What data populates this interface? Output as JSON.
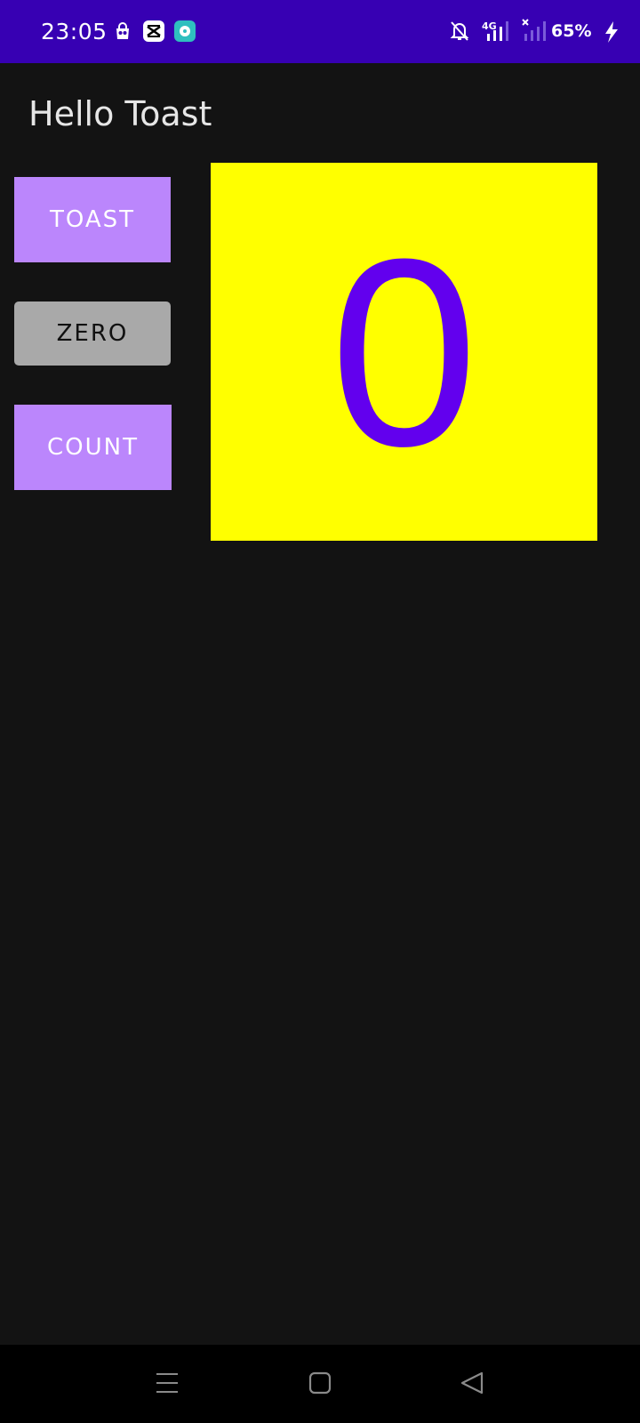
{
  "status_bar": {
    "time": "23:05",
    "network": "4G",
    "battery": "65%",
    "icons": [
      "shopping-bag-icon",
      "capcut-icon",
      "assistant-icon",
      "bell-off-icon",
      "signal-icon",
      "signal-no-sim-icon",
      "charging-bolt-icon"
    ]
  },
  "app": {
    "title": "Hello Toast"
  },
  "buttons": {
    "toast": "TOAST",
    "zero": "ZERO",
    "count": "COUNT"
  },
  "counter": {
    "value": "0"
  },
  "colors": {
    "status_bar": "#3700b3",
    "background": "#131313",
    "accent_button": "#bb86fc",
    "zero_button": "#a9a9a9",
    "panel": "#ffff00",
    "count_text": "#6200ee"
  },
  "nav_bar": {
    "icons": [
      "recents-icon",
      "home-icon",
      "back-icon"
    ]
  }
}
